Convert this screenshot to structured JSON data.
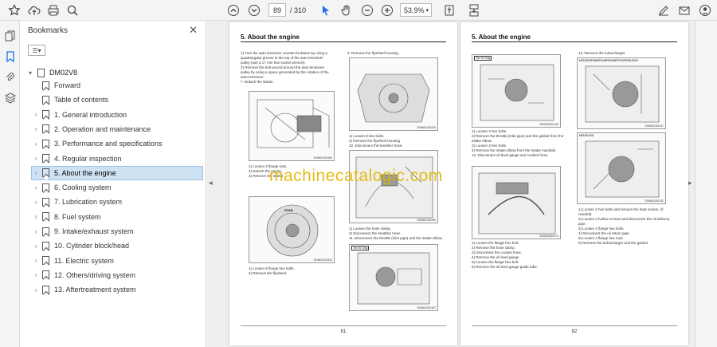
{
  "toolbar": {
    "current_page": "89",
    "total_pages": "/ 310",
    "zoom": "53,9%"
  },
  "panel": {
    "title": "Bookmarks",
    "close": "✕",
    "tools": "☰▾",
    "root": "DM02V8",
    "items": [
      {
        "label": "Forward",
        "expandable": false
      },
      {
        "label": "Table of contents",
        "expandable": false
      },
      {
        "label": "1. General introduction",
        "expandable": true
      },
      {
        "label": "2. Operation and maintenance",
        "expandable": true
      },
      {
        "label": "3. Performance and specifications",
        "expandable": true
      },
      {
        "label": "4. Regular inspection",
        "expandable": true
      },
      {
        "label": "5. About the engine",
        "expandable": true,
        "selected": true
      },
      {
        "label": "6. Cooling system",
        "expandable": true
      },
      {
        "label": "7. Lubrication system",
        "expandable": true
      },
      {
        "label": "8. Fuel system",
        "expandable": true
      },
      {
        "label": "9. Intake/exhaust system",
        "expandable": true
      },
      {
        "label": "10. Cylinder block/head",
        "expandable": true
      },
      {
        "label": "11. Electric system",
        "expandable": true
      },
      {
        "label": "12. Others/driving system",
        "expandable": true
      },
      {
        "label": "13. Aftertreatment system",
        "expandable": true
      }
    ]
  },
  "pages": {
    "left": {
      "header": "5. About the engine",
      "number": "81",
      "col1_text_a": "1) Turn the auto tensioner counterclockwise by using a quadrangular groove in the top of the auto tensioner pulley (use a 17 mm hex socket wrench).\n2) Remove the belt wound around the auto tensioner pulley by using a space generated by the rotation of the auto tensioner.\n7. Detach the starter.",
      "col1_text_b": "1) Loosen 3 flange nuts.\n2) Detach the starter.\n3) Remove the starter.",
      "col1_text_c": "1) Loosen 8 flange hex bolts.\n2) Remove the flywheel.",
      "col2_text_a": "9. Remove the flywheel housing.",
      "col2_text_b": "1) Loosen 8 hex bolts.\n2) Remove the flywheel housing.\n10. Disconnect the breather hose.",
      "col2_text_c": "1) Loosen the hose clamp.\n2) Disconnect the breather hose.\n11. Disconnect the throttle (inlet pipe) and the intake elbow.",
      "img_labels": [
        "EDM02190309",
        "EDM02190310",
        "EDM02190311",
        "EDM02190349",
        "EDM02230167"
      ],
      "img_tag": "Tier IV Only",
      "label_stamp": "STAR"
    },
    "right": {
      "header": "5. About the engine",
      "number": "82",
      "col1_text_a": "1) Loosen 3 hex bolts.\n2) Remove the throttle (inlet pipe) and the gasket from the intake elbow.\n3) Loosen 3 hex bolts.\n4) Remove the intake elbow from the intake manifold.\n12. Disconnect oil level gauge and coolant hose.",
      "col1_text_b": "1) Loosen the flange hex bolt.\n2) Remove the hose clamp.\n3) Disconnect the coolant hose.\n4) Remove the oil level gauge.\n5) Loosen the flange hex bolt.\n6) Remove the oil level gauge guide tube.",
      "col2_text_a": "13. Remove the turbocharger.",
      "col2_model_a": "MFE02MFE00MFE04/MFE05/MFE07/MFE00LE000",
      "col2_model_b": "MFE00LE08",
      "col2_text_b": "1) Loosen 2 hex bolts and remove the heat screen. (if needed)\n2) Loosen 2 hollow screws and disconnect the oil delivery pipe.\n3) Loosen 4 flange hex bolts.\n4) Disconnect the oil return pipe.\n5) Loosen 4 flange hex nuts.\n6) Remove the turbocharger and the gasket.",
      "img_labels": [
        "EDM02230149",
        "EDM02230171",
        "EDM02230147",
        "EDM02230142"
      ],
      "img_tag": "Tier IV Only"
    }
  },
  "watermark": "machinecatalogic.com"
}
